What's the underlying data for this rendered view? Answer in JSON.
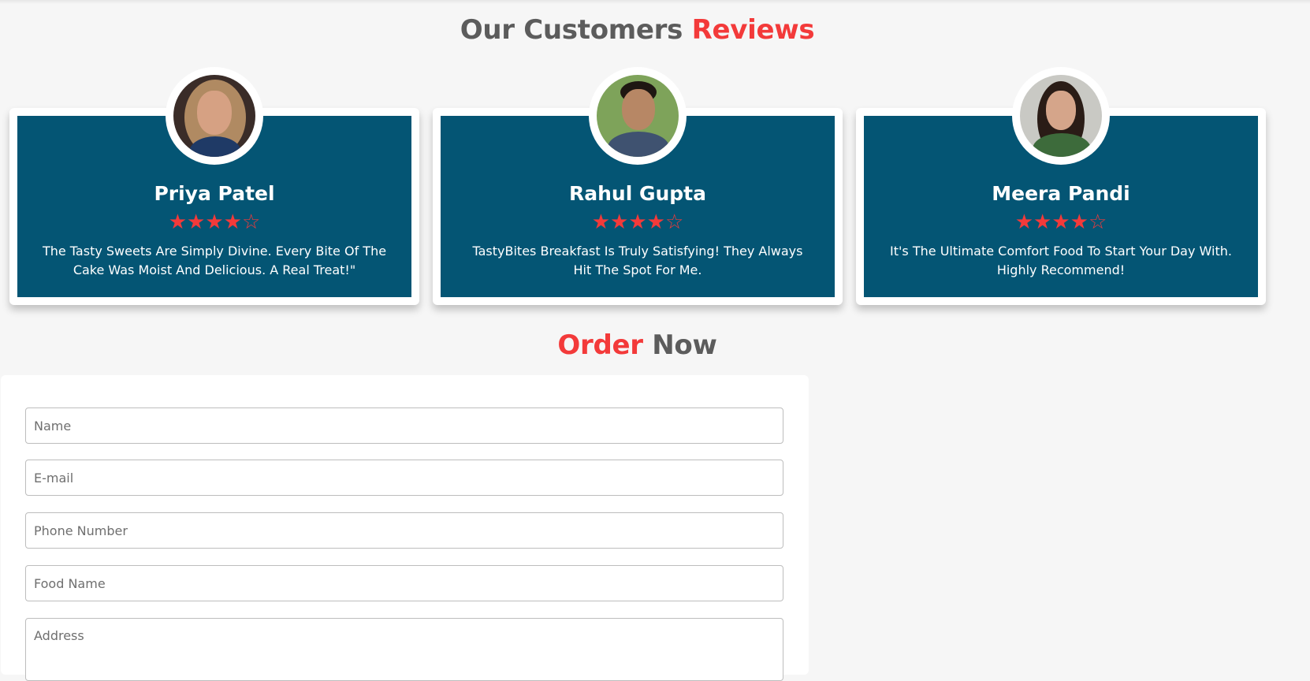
{
  "reviews_section": {
    "title_part1": "Our Customers",
    "title_part2": "Reviews",
    "reviews": [
      {
        "name": "Priya Patel",
        "rating": 4,
        "max_rating": 5,
        "quote": "The Tasty Sweets Are Simply Divine. Every Bite Of The Cake Was Moist And Delicious. A Real Treat!\""
      },
      {
        "name": "Rahul Gupta",
        "rating": 4,
        "max_rating": 5,
        "quote": "TastyBites Breakfast Is Truly Satisfying! They Always Hit The Spot For Me."
      },
      {
        "name": "Meera Pandi",
        "rating": 4,
        "max_rating": 5,
        "quote": "It's The Ultimate Comfort Food To Start Your Day With. Highly Recommend!"
      }
    ]
  },
  "order_section": {
    "title_part1": "Order",
    "title_part2": "Now",
    "fields": {
      "name_placeholder": "Name",
      "email_placeholder": "E-mail",
      "phone_placeholder": "Phone Number",
      "food_placeholder": "Food Name",
      "address_placeholder": "Address"
    }
  },
  "colors": {
    "accent": "#f33a3a",
    "card_bg": "#045574",
    "heading_gray": "#5c5c5c",
    "page_bg": "#f6f6f6"
  },
  "icons": {
    "filled_star": "star-filled-icon",
    "empty_star": "star-outline-icon"
  }
}
